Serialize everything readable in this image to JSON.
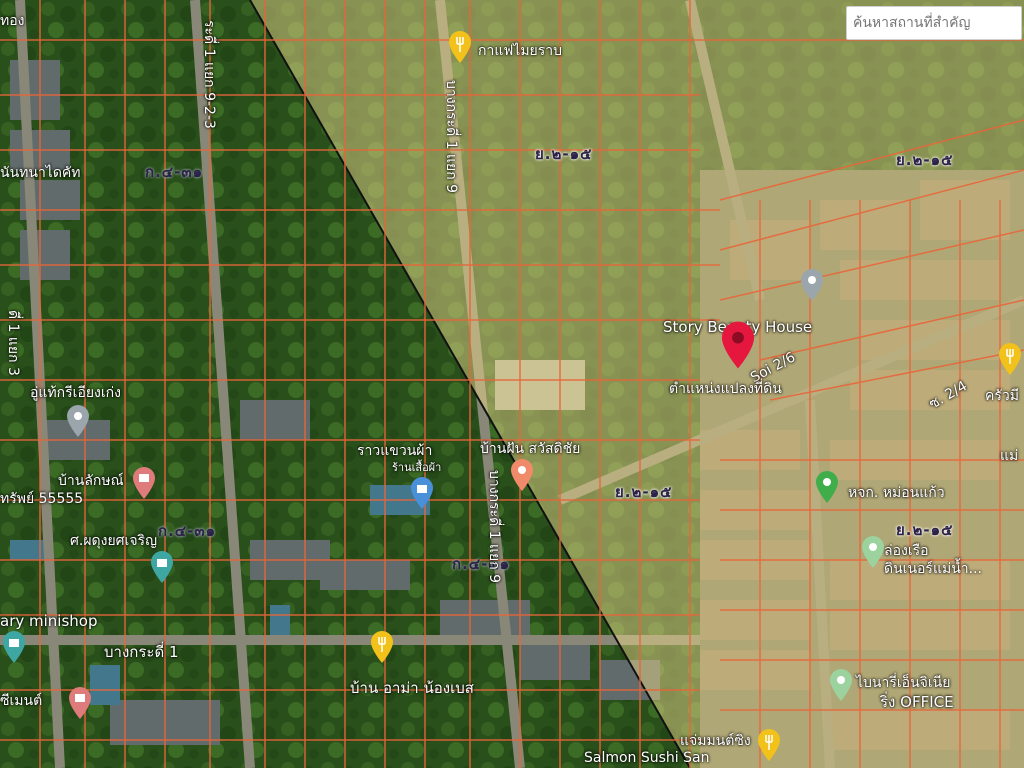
{
  "search": {
    "placeholder": "ค้นหาสถานที่สำคัญ"
  },
  "selected_parcel": {
    "label": "ตำแหน่งแปลงที่ดิน",
    "marker_color": "#e5173f"
  },
  "zoning": [
    {
      "code": "ย.๒-๑๕"
    },
    {
      "code": "ย.๒-๑๕"
    },
    {
      "code": "ย.๒-๑๕"
    },
    {
      "code": "ย.๒-๑๕"
    },
    {
      "code": "ก.๔-๓๑"
    },
    {
      "code": "ก.๔-๓๑"
    },
    {
      "code": "ก.๔-๓๑"
    }
  ],
  "roads": {
    "soi_2_6": "Soi 2/6",
    "bangkrati_1_9": "บางกระดี่ 1 แยก 9",
    "bangkrati_1_9_2_3": "ระดี่ 1 แยก 9-2-3",
    "bangkrati_1": "บางกระดี่ 1",
    "bangkrati_1_9_lower": "บางกระดี่ 1 แยก 9",
    "soi_2_4": "ซ. 2/4",
    "left_edge": "ดี่ 1 แยก 3"
  },
  "places": {
    "cafe": "กาแฟไมยราบ",
    "story_beauty": "Story Beauty House",
    "baan_fan": "บ้านฝัน สวัสดิชัย",
    "raan_khao": "ราวแขวนผ้า",
    "raan_khao_sub": "ร้านเสื้อผ้า",
    "baan_lak": "บ้านลักษณ์",
    "sap_55555": "ทรัพย์ 55555",
    "thanna": "นันทนาไดคัท",
    "uthai": "อู่แท้กรีเอียงเก่ง",
    "sor_phadung": "ศ.ผดุงยศเจริญ",
    "minishop": "ary minishop",
    "baan_ama": "บ้าน อาม่า น้องเบส",
    "salmon": "Salmon Sushi San",
    "mo_aon": "หจก. หม่อนแก้ว",
    "long_ruea": "ล่องเรือ",
    "dinner": "ดินเนอร์แม่น้ำ...",
    "binary": "ไบนารี่เอ็นจิเนีย",
    "binary_office": "ริ่ง OFFICE",
    "cement": "ซีเมนต์",
    "jaem": "แจ่มมนต์ซิง",
    "khrua": "ครัวมี",
    "thong": "ทอง",
    "right_edge": "แม่"
  },
  "colors": {
    "parcel_line": "#e8663a",
    "highlight_overlay": "#e8d58a",
    "marker_red": "#e5173f",
    "marker_yellow": "#f2c21a",
    "marker_green": "#3fae4a",
    "marker_teal": "#3ea7a3"
  }
}
